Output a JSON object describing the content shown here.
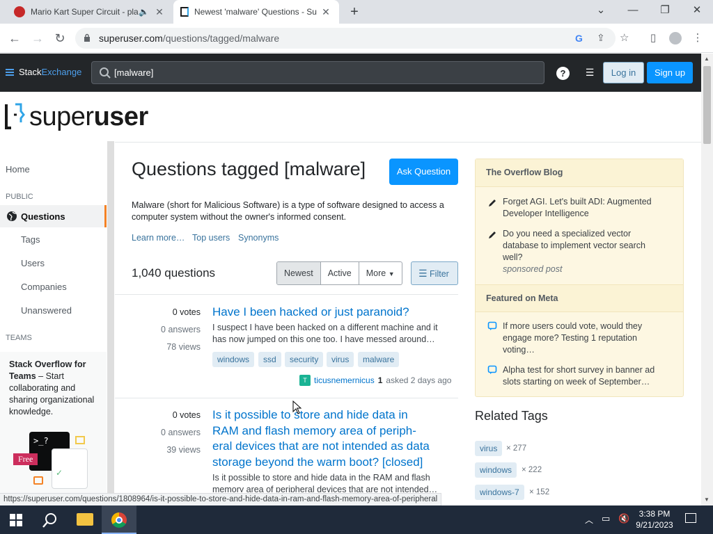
{
  "browser": {
    "tabs": [
      {
        "title": "Mario Kart Super Circuit - pla",
        "active": false,
        "audio": true
      },
      {
        "title": "Newest 'malware' Questions - Su",
        "active": true
      }
    ],
    "url_host": "superuser.com",
    "url_path": "/questions/tagged/malware",
    "status_url": "https://superuser.com/questions/1808964/is-it-possible-to-store-and-hide-data-in-ram-and-flash-memory-area-of-peripheral"
  },
  "topbar": {
    "logo_stack": "Stack",
    "logo_exchange": "Exchange",
    "search_value": "[malware]",
    "login_label": "Log in",
    "signup_label": "Sign up"
  },
  "site": {
    "logo_light": "super",
    "logo_bold": "user"
  },
  "sidebar": {
    "home": "Home",
    "public_heading": "PUBLIC",
    "questions": "Questions",
    "tags": "Tags",
    "users": "Users",
    "companies": "Companies",
    "unanswered": "Unanswered",
    "teams_heading": "TEAMS",
    "teams_bold": "Stack Overflow for Teams",
    "teams_text": " – Start collaborating and sharing organizational knowledge.",
    "free_badge": "Free"
  },
  "main": {
    "title": "Questions tagged [malware]",
    "ask_label": "Ask Question",
    "description": "Malware (short for Malicious Software) is a type of software designed to access a computer system without the owner's informed consent.",
    "learn_more": "Learn more…",
    "top_users": "Top users",
    "synonyms": "Synonyms",
    "count": "1,040 questions",
    "sort": [
      "Newest",
      "Active",
      "More"
    ],
    "filter_label": "Filter",
    "questions": [
      {
        "votes": "0 votes",
        "answers": "0 answers",
        "views": "78 views",
        "title": "Have I been hacked or just paranoid?",
        "excerpt": "I suspect I have been hacked on a different machine and it has now jumped on this one too. I have messed around…",
        "tags": [
          "windows",
          "ssd",
          "security",
          "virus",
          "malware"
        ],
        "user": "ticusnemernicus",
        "rep": "1",
        "asked": "asked 2 days ago",
        "avatar_letter": "T"
      },
      {
        "votes": "0 votes",
        "answers": "0 answers",
        "views": "39 views",
        "title_lines": [
          "Is it possible to store and hide data in",
          "RAM and flash memory area of periph-",
          "eral devices that are not intended as data",
          "storage beyond the warm boot? [closed]"
        ],
        "excerpt": "Is it possible to store and hide data in the RAM and flash memory area of peripheral devices that are not intended…"
      }
    ]
  },
  "right": {
    "blog_heading": "The Overflow Blog",
    "blog_items": [
      "Forget AGI. Let's built ADI: Augmented Developer Intelligence",
      "Do you need a specialized vector database to implement vector search well?"
    ],
    "sponsored": "sponsored post",
    "meta_heading": "Featured on Meta",
    "meta_items": [
      "If more users could vote, would they engage more? Testing 1 reputation voting…",
      "Alpha test for short survey in banner ad slots starting on week of September…"
    ],
    "related_title": "Related Tags",
    "related_tags": [
      {
        "name": "virus",
        "count": "× 277"
      },
      {
        "name": "windows",
        "count": "× 222"
      },
      {
        "name": "windows-7",
        "count": "× 152"
      }
    ]
  },
  "taskbar": {
    "time": "3:38 PM",
    "date": "9/21/2023"
  },
  "colors": {
    "accent": "#0a95ff",
    "link": "#0074cc",
    "topbar": "#232629",
    "blog_bg": "#fdf7e2",
    "nav_active_border": "#f48225"
  }
}
